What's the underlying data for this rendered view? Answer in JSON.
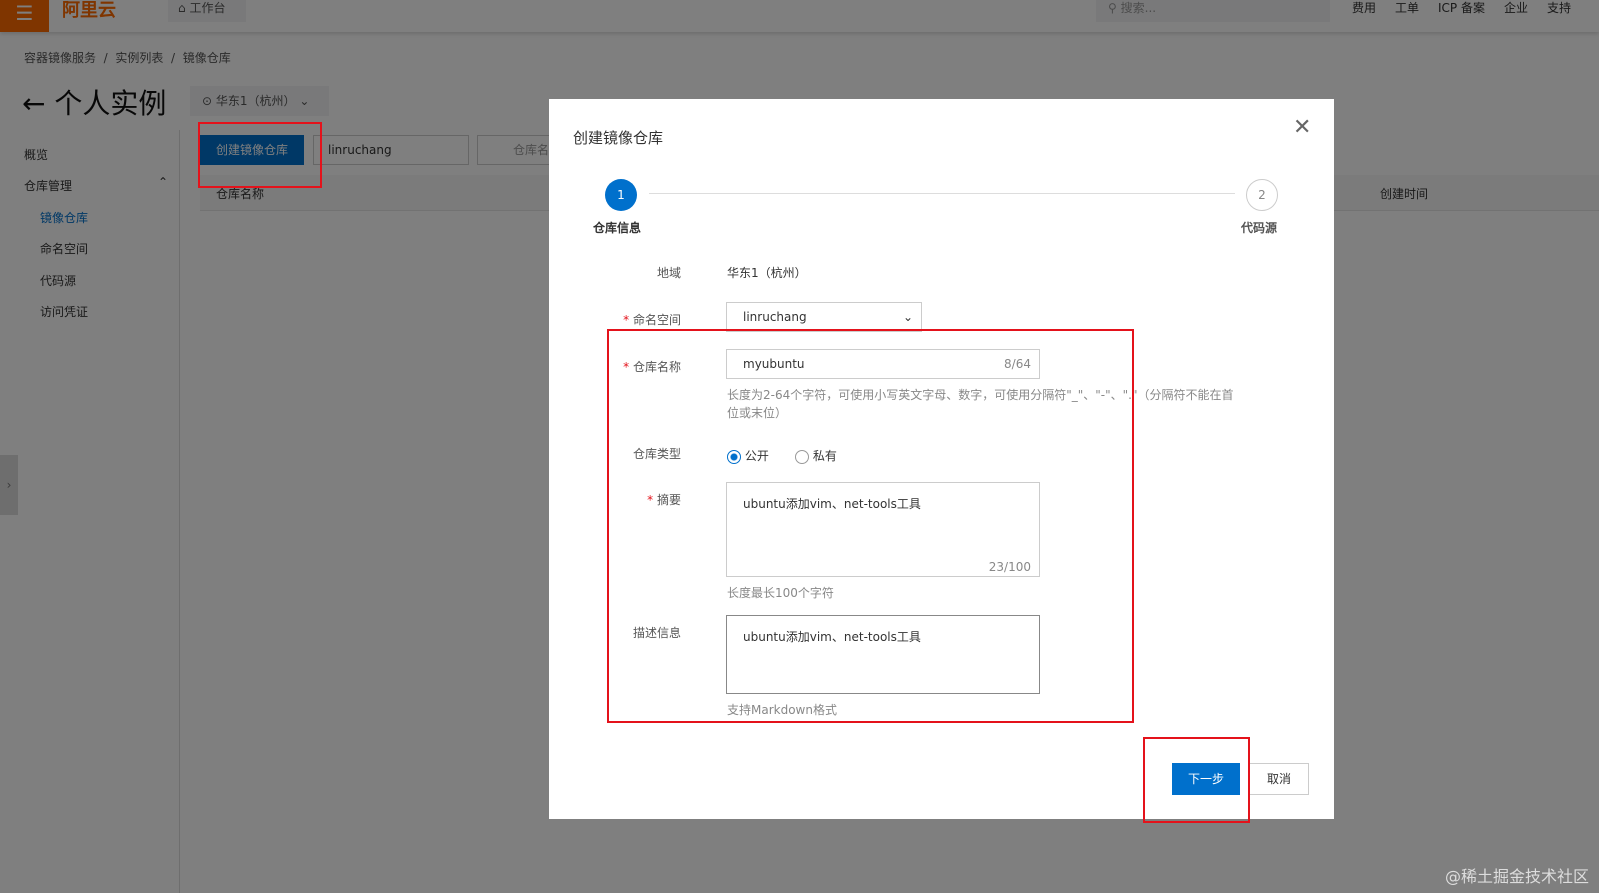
{
  "topbar": {
    "logo": "阿里云",
    "workbench": "工作台",
    "search_placeholder": "搜索...",
    "nav": [
      "费用",
      "工单",
      "ICP 备案",
      "企业",
      "支持"
    ]
  },
  "breadcrumb": [
    "容器镜像服务",
    "/",
    "实例列表",
    "/",
    "镜像仓库"
  ],
  "page_title": "个人实例",
  "region": "华东1（杭州）",
  "sidebar": {
    "overview": "概览",
    "repo_mgmt": "仓库管理",
    "items": [
      "镜像仓库",
      "命名空间",
      "代码源",
      "访问凭证"
    ]
  },
  "toolbar": {
    "create": "创建镜像仓库",
    "namespace": "linruchang",
    "search_placeholder": "仓库名称"
  },
  "table": {
    "col_name": "仓库名称",
    "col_created": "创建时间"
  },
  "modal": {
    "title": "创建镜像仓库",
    "steps": [
      {
        "num": "1",
        "label": "仓库信息"
      },
      {
        "num": "2",
        "label": "代码源"
      }
    ],
    "region_label": "地域",
    "region_value": "华东1（杭州）",
    "namespace_label": "命名空间",
    "namespace_value": "linruchang",
    "repo_name_label": "仓库名称",
    "repo_name_value": "myubuntu",
    "repo_name_count": "8/64",
    "repo_name_hint": "长度为2-64个字符，可使用小写英文字母、数字，可使用分隔符\"_\"、\"-\"、\".\"（分隔符不能在首位或末位）",
    "type_label": "仓库类型",
    "type_public": "公开",
    "type_private": "私有",
    "type_selected": "公开",
    "summary_label": "摘要",
    "summary_value": "ubuntu添加vim、net-tools工具",
    "summary_count": "23/100",
    "summary_hint": "长度最长100个字符",
    "desc_label": "描述信息",
    "desc_value": "ubuntu添加vim、net-tools工具",
    "desc_hint": "支持Markdown格式",
    "next": "下一步",
    "cancel": "取消",
    "required_mark": "*"
  },
  "watermark": "@稀土掘金技术社区"
}
